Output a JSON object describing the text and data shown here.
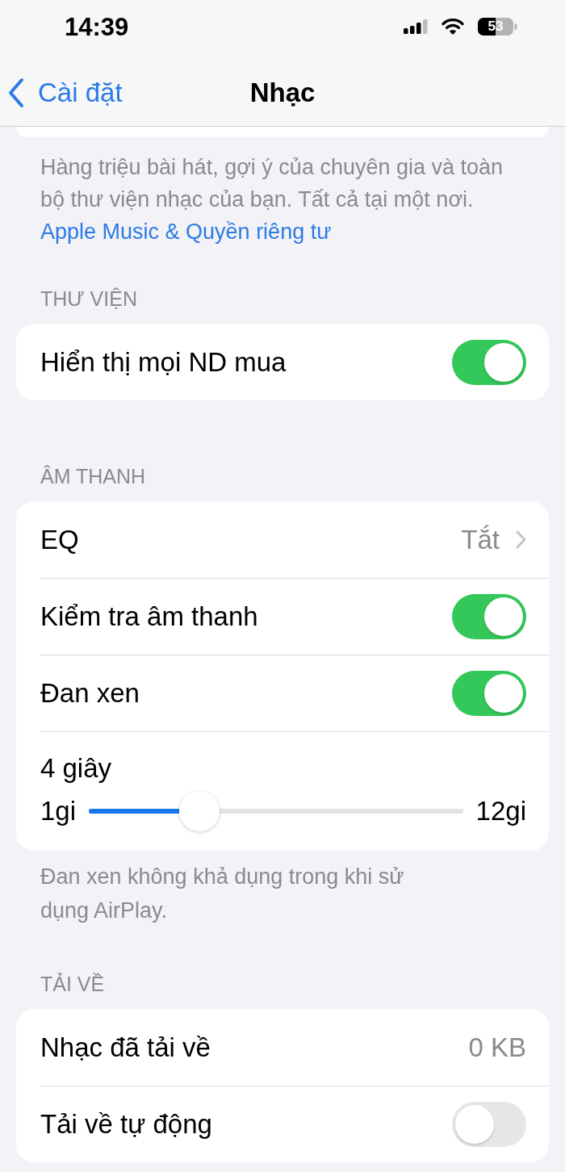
{
  "status_bar": {
    "time": "14:39",
    "battery": "53"
  },
  "nav_bar": {
    "back_label": "Cài đặt",
    "title": "Nhạc"
  },
  "intro": {
    "text": "Hàng triệu bài hát, gợi ý của chuyên gia và toàn bộ thư viện nhạc của bạn. Tất cả tại một nơi.",
    "link": "Apple Music & Quyền riêng tư"
  },
  "sections": [
    {
      "header": "THƯ VIỆN",
      "rows": [
        {
          "kind": "toggle",
          "label": "Hiển thị mọi ND mua",
          "on": true
        }
      ]
    },
    {
      "header": "ÂM THANH",
      "rows": [
        {
          "kind": "disclosure",
          "label": "EQ",
          "value": "Tắt"
        },
        {
          "kind": "toggle",
          "label": "Kiểm tra âm thanh",
          "on": true
        },
        {
          "kind": "toggle",
          "label": "Đan xen",
          "on": true
        },
        {
          "kind": "slider",
          "label": "4 giây",
          "min_label": "1gi",
          "max_label": "12gi",
          "level": 0.27
        }
      ],
      "footer": "Đan xen không khả dụng trong khi sử dụng AirPlay."
    },
    {
      "header": "TẢI VỀ",
      "rows": [
        {
          "kind": "value",
          "label": "Nhạc đã tải về",
          "value": "0 KB"
        },
        {
          "kind": "toggle",
          "label": "Tải về tự động",
          "on": false
        }
      ]
    }
  ]
}
